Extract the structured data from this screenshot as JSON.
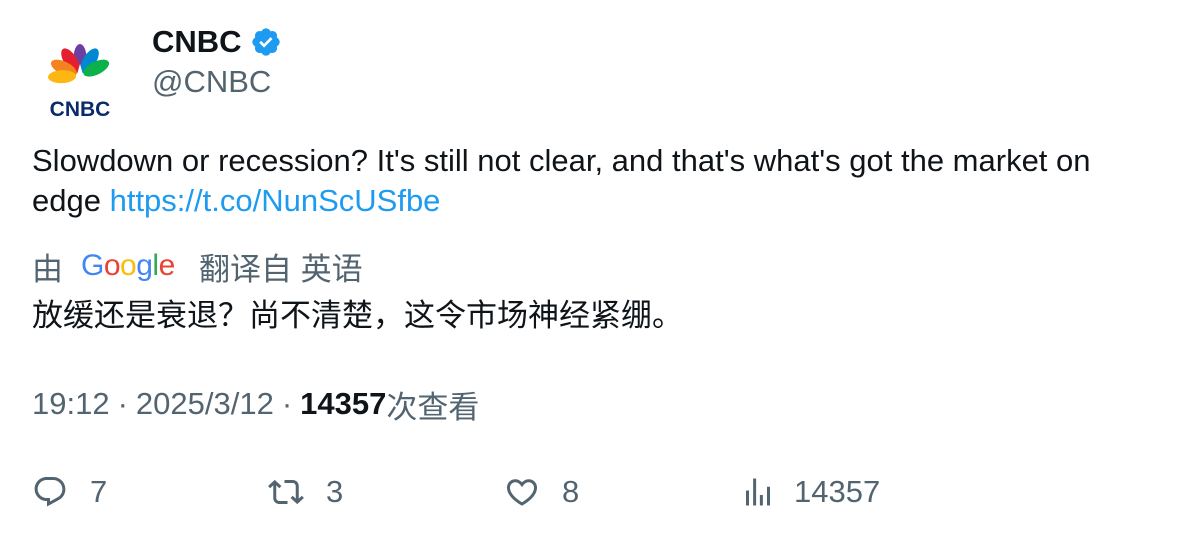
{
  "author": {
    "display_name": "CNBC",
    "handle": "@CNBC",
    "avatar_icon": "cnbc-peacock-logo",
    "logo_text": "CNBC",
    "verified_icon": "verified-badge-icon",
    "verified_color": "#1d9bf0"
  },
  "tweet": {
    "text": "Slowdown or recession? It's still not clear, and that's what's got the market on edge",
    "link": "https://t.co/NunScUSfbe"
  },
  "translation": {
    "prefix": "由",
    "provider": "Google",
    "suffix": "翻译自 英语",
    "text": "放缓还是衰退？尚不清楚，这令市场神经紧绷。"
  },
  "meta": {
    "time": "19:12",
    "separator": "·",
    "date": "2025/3/12",
    "views_count": "14357",
    "views_label": "次查看"
  },
  "actions": {
    "reply": {
      "icon": "reply-icon",
      "count": "7"
    },
    "retweet": {
      "icon": "retweet-icon",
      "count": "3"
    },
    "like": {
      "icon": "heart-icon",
      "count": "8"
    },
    "views": {
      "icon": "bar-chart-icon",
      "count": "14357"
    }
  },
  "colors": {
    "text_primary": "#0f1419",
    "text_secondary": "#536471",
    "link": "#1d9bf0"
  }
}
